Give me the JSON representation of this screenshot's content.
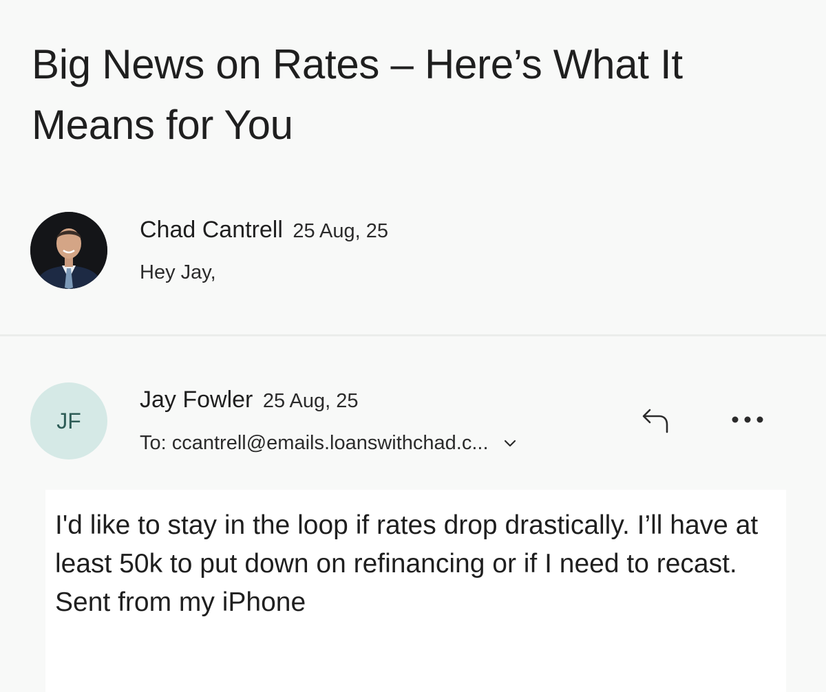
{
  "email": {
    "subject": "Big News on Rates – Here’s What It Means for You"
  },
  "messages": [
    {
      "sender": "Chad Cantrell",
      "date": "25 Aug, 25",
      "snippet": "Hey Jay,",
      "avatar": "photo"
    },
    {
      "sender": "Jay Fowler",
      "initials": "JF",
      "date": "25 Aug, 25",
      "to": "To: ccantrell@emails.loanswithchad.c...",
      "body": [
        "I'd like to stay in the loop if rates drop drastically. I’ll have at least 50k to put down on refinancing or if I need to recast.",
        "Sent from my iPhone"
      ]
    }
  ],
  "icons": {
    "reply": "reply-icon",
    "more": "more-options-icon",
    "expand": "chevron-down-icon"
  },
  "colors": {
    "background": "#f8f9f8",
    "initials_avatar_bg": "#d5e9e6",
    "initials_avatar_text": "#2e5d57",
    "text": "#1f1f1f"
  }
}
